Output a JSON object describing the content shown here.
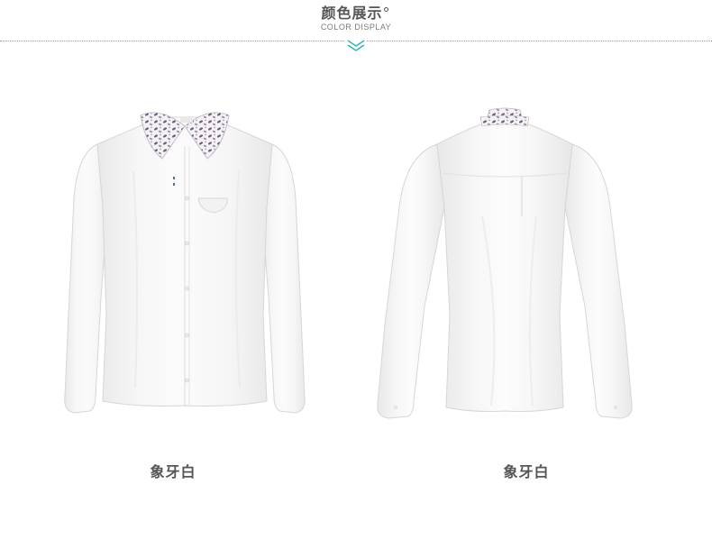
{
  "section": {
    "title": "颜色展示",
    "title_mark": "°",
    "subtitle": "COLOR DISPLAY"
  },
  "products": [
    {
      "view": "front",
      "color_name": "象牙白"
    },
    {
      "view": "back",
      "color_name": "象牙白"
    }
  ],
  "colors": {
    "accent": "#2fb3b3",
    "text": "#555555",
    "divider": "#9a9a9a"
  },
  "icons": {
    "divider_mark": "double-chevron-down-icon"
  }
}
